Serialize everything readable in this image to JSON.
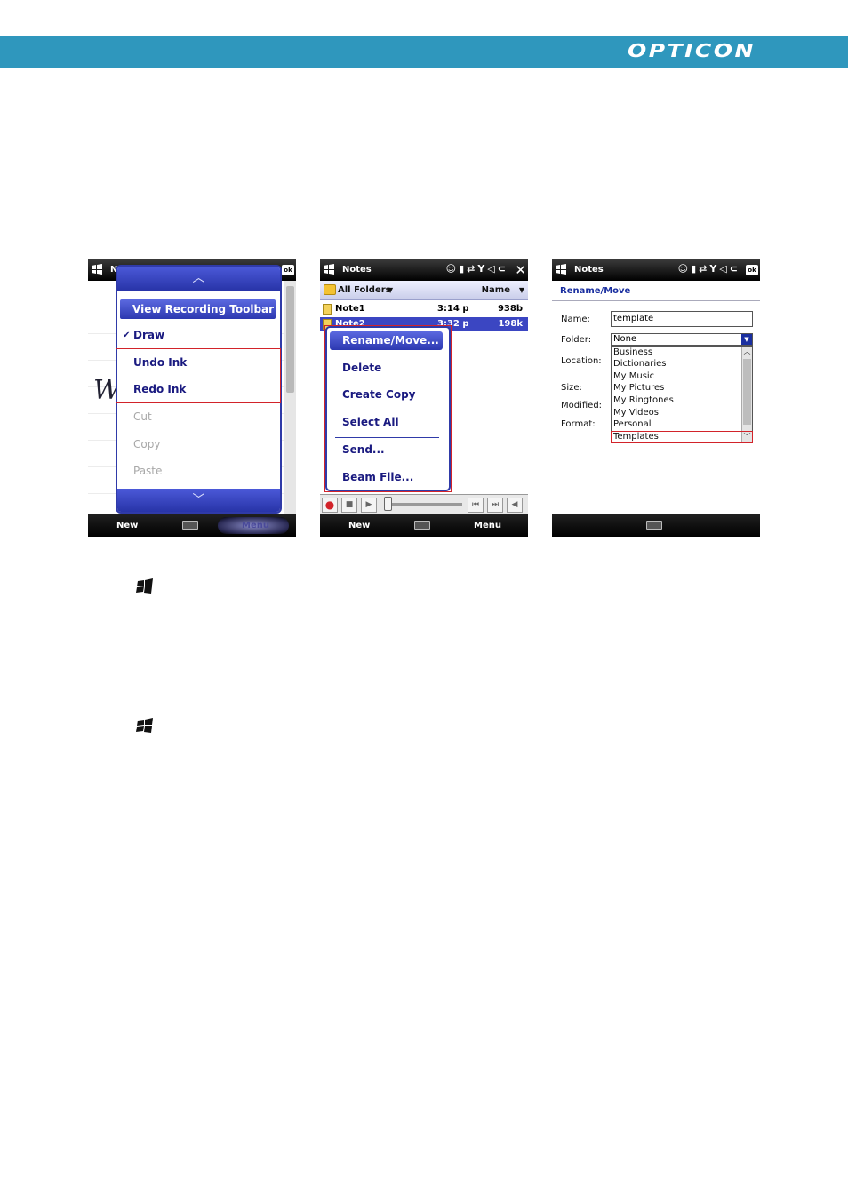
{
  "header": {
    "brand": "OPTICON",
    "bar_color": "#2f97bd"
  },
  "screen1": {
    "title_text": "N",
    "ink_text": "W",
    "menu": {
      "items": [
        {
          "label": "View Recording Toolbar",
          "state": "selected"
        },
        {
          "label": "Draw",
          "state": "checked"
        },
        {
          "label": "Undo Ink",
          "state": "enabled"
        },
        {
          "label": "Redo Ink",
          "state": "enabled"
        },
        {
          "label": "Cut",
          "state": "disabled"
        },
        {
          "label": "Copy",
          "state": "disabled"
        },
        {
          "label": "Paste",
          "state": "disabled"
        }
      ]
    },
    "softkeys": {
      "left": "New",
      "right": "Menu"
    }
  },
  "screen2": {
    "title": "Notes",
    "folder_filter": "All Folders",
    "sort_by": "Name",
    "files": [
      {
        "name": "Note1",
        "time": "3:14 p",
        "size": "938b",
        "selected": false
      },
      {
        "name": "Note2",
        "time": "3:32 p",
        "size": "198k",
        "selected": true
      }
    ],
    "context_menu": [
      "Rename/Move...",
      "Delete",
      "Create Copy",
      "Select All",
      "Send...",
      "Beam File..."
    ],
    "softkeys": {
      "left": "New",
      "right": "Menu"
    }
  },
  "screen3": {
    "title": "Notes",
    "dialog_title": "Rename/Move",
    "labels": {
      "name": "Name:",
      "folder": "Folder:",
      "location": "Location:",
      "size": "Size:",
      "modified": "Modified:",
      "format": "Format:"
    },
    "name_value": "template",
    "folder_value": "None",
    "folder_options": [
      "Business",
      "Dictionaries",
      "My Music",
      "My Pictures",
      "My Ringtones",
      "My Videos",
      "Personal",
      "Templates"
    ],
    "highlighted_option": "Templates"
  },
  "colors": {
    "highlight_box": "#d2232a",
    "menu_blue": "#2f3aa8"
  }
}
